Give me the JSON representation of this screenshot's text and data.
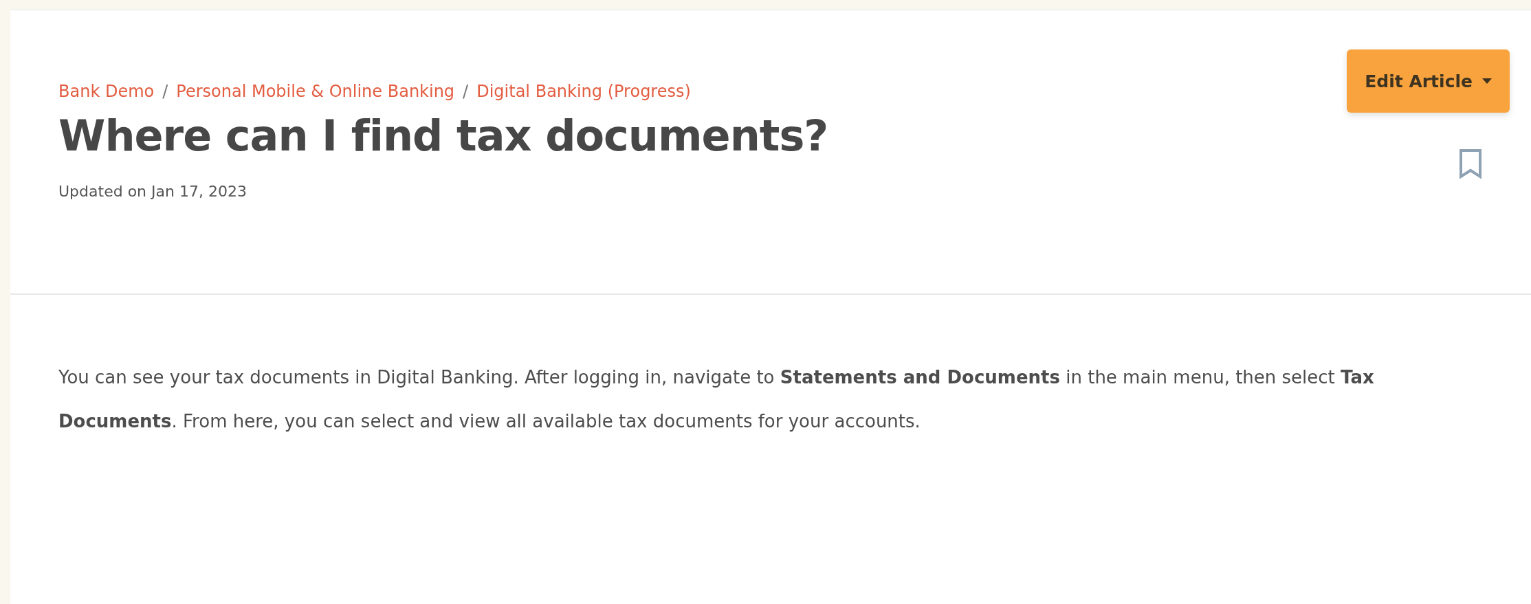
{
  "breadcrumbs": [
    "Bank Demo",
    "Personal Mobile & Online Banking",
    "Digital Banking (Progress)"
  ],
  "breadcrumb_separator": "/",
  "title": "Where can I find tax documents?",
  "updated": "Updated on Jan 17, 2023",
  "edit_button": {
    "label": "Edit Article"
  },
  "bookmark": {
    "selected": false
  },
  "body": "You can see your tax documents in Digital Banking. After logging in, navigate to **Statements and Documents** in the main menu, then select **Tax Documents**. From here, you can select and view all available tax documents for your accounts."
}
